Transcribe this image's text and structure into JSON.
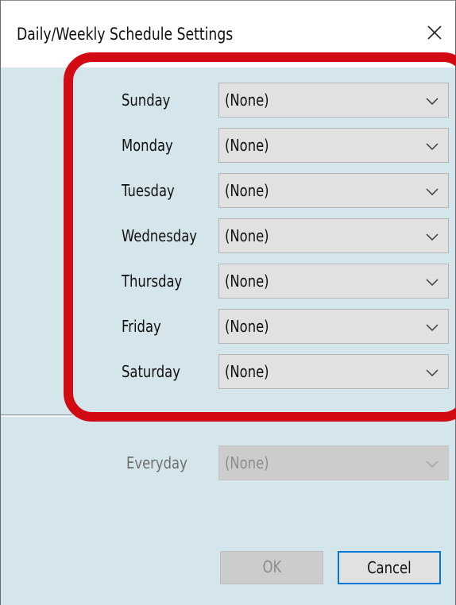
{
  "dialog": {
    "title": "Daily/Weekly Schedule Settings",
    "close_glyph": "×"
  },
  "days": [
    {
      "label": "Sunday",
      "value": "(None)"
    },
    {
      "label": "Monday",
      "value": "(None)"
    },
    {
      "label": "Tuesday",
      "value": "(None)"
    },
    {
      "label": "Wednesday",
      "value": "(None)"
    },
    {
      "label": "Thursday",
      "value": "(None)"
    },
    {
      "label": "Friday",
      "value": "(None)"
    },
    {
      "label": "Saturday",
      "value": "(None)"
    }
  ],
  "everyday": {
    "label": "Everyday",
    "value": "(None)",
    "enabled": false
  },
  "buttons": {
    "ok": {
      "label": "OK",
      "enabled": false
    },
    "cancel": {
      "label": "Cancel",
      "enabled": true
    }
  },
  "colors": {
    "dialog_background": "#d4e6ec",
    "highlight_border": "#d20a14",
    "focus_border": "#0078d7"
  },
  "icons": {
    "close": "close-icon",
    "dropdown": "chevron-down-icon"
  }
}
